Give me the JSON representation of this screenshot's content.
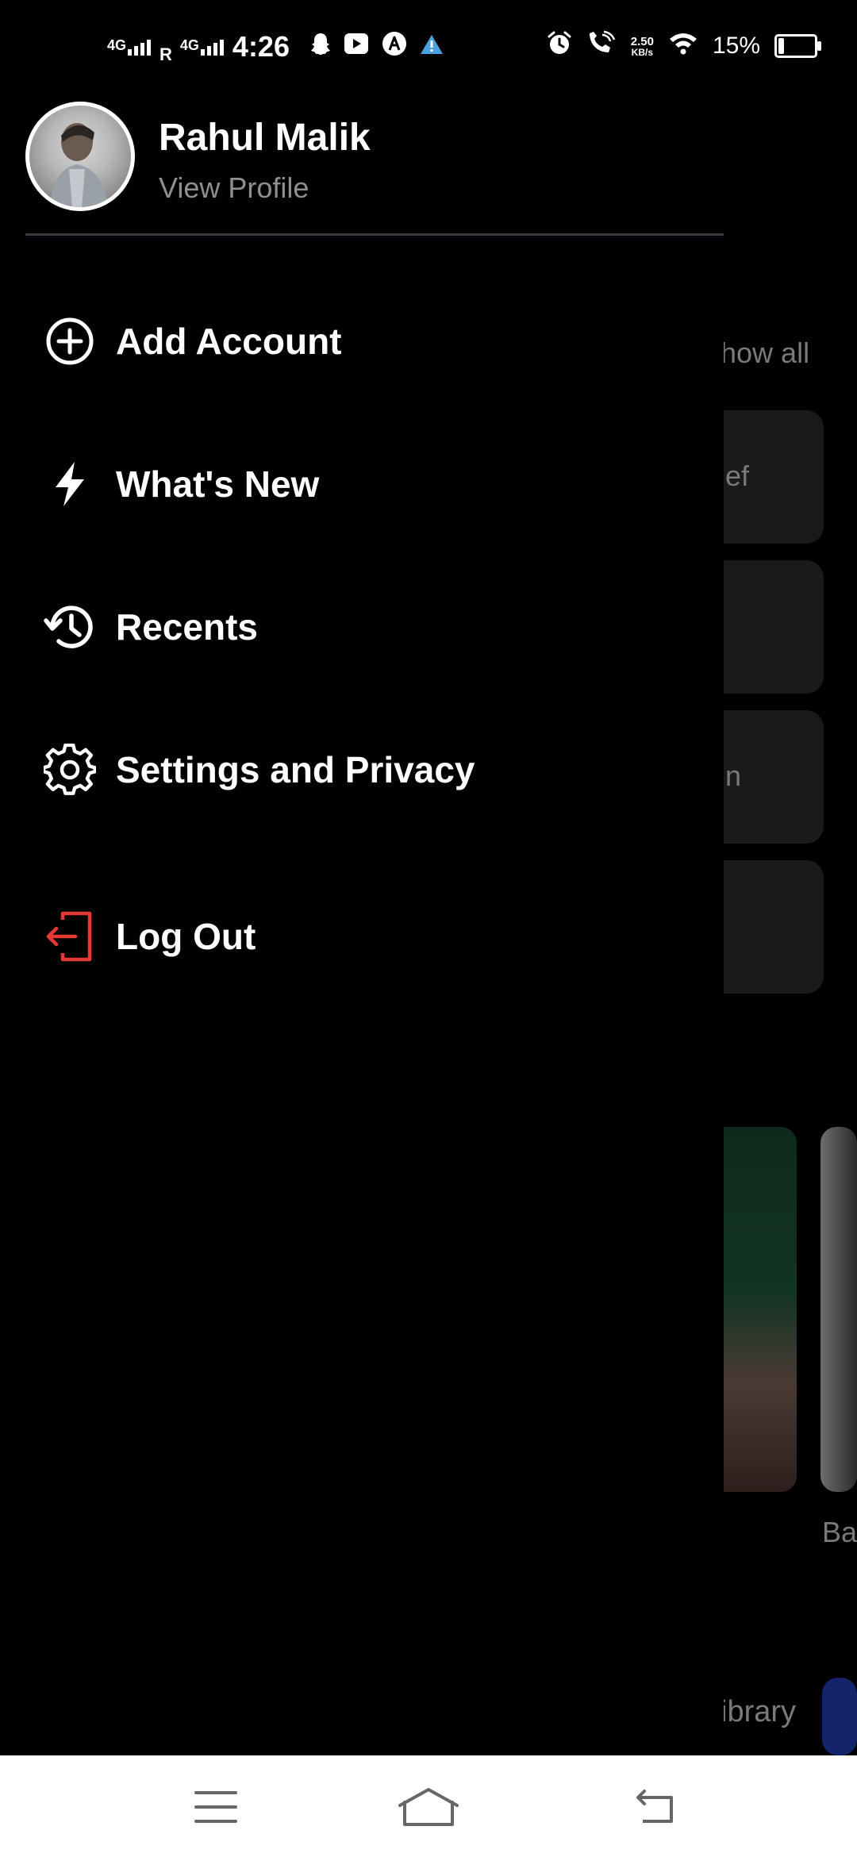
{
  "status_bar": {
    "signal_1": "4G",
    "roaming": "R",
    "signal_2": "4G",
    "time": "4:26",
    "speed_value": "2.50",
    "speed_unit": "KB/s",
    "battery_percent": "15%",
    "battery_level": 0.15,
    "icons": [
      "snapchat-icon",
      "youtube-icon",
      "app-a-icon",
      "warning-icon",
      "alarm-icon",
      "wifi-calling-icon",
      "wifi-icon",
      "battery-icon"
    ]
  },
  "profile": {
    "name": "Rahul Malik",
    "subtitle": "View Profile"
  },
  "menu": [
    {
      "label": "Add Account",
      "icon": "plus-circle-icon"
    },
    {
      "label": "What's New",
      "icon": "lightning-icon"
    },
    {
      "label": "Recents",
      "icon": "history-icon"
    },
    {
      "label": "Settings and Privacy",
      "icon": "gear-icon"
    },
    {
      "label": "Log Out",
      "icon": "logout-icon",
      "color": "#e53935"
    }
  ],
  "background": {
    "show_all": "how all",
    "card_text_1": "ef",
    "card_text_3": "n",
    "caption": "Ba",
    "library": "ibrary"
  },
  "navbar": {
    "icons": [
      "menu-icon",
      "home-icon",
      "back-icon"
    ]
  },
  "colors": {
    "background": "#000000",
    "text_primary": "#ffffff",
    "text_secondary": "#8e8e93",
    "logout_red": "#e53935",
    "navbar": "#ffffff"
  }
}
